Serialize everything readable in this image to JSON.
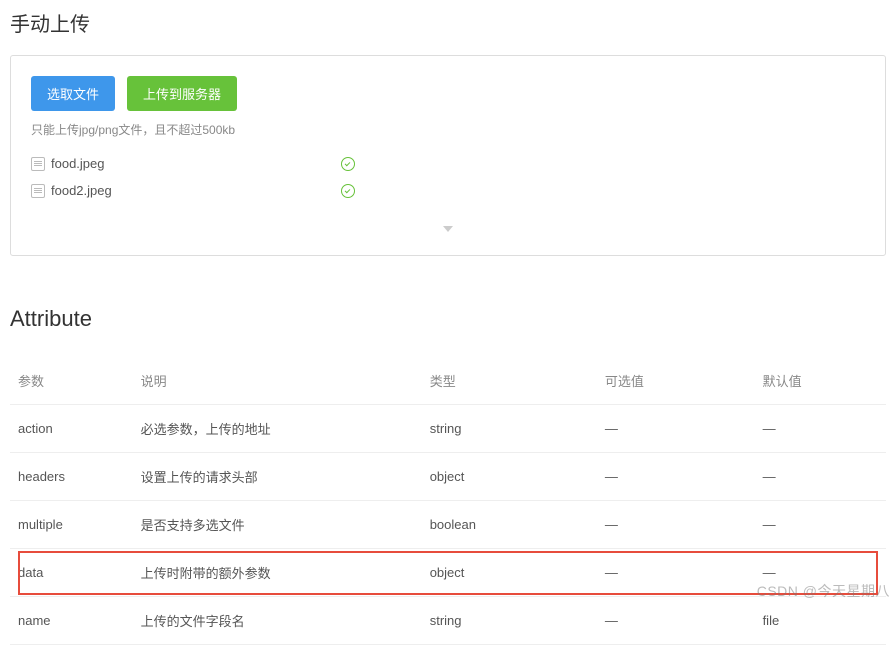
{
  "header": {
    "title": "手动上传"
  },
  "upload": {
    "select_btn": "选取文件",
    "submit_btn": "上传到服务器",
    "hint": "只能上传jpg/png文件，且不超过500kb",
    "files": [
      {
        "name": "food.jpeg"
      },
      {
        "name": "food2.jpeg"
      }
    ]
  },
  "attribute": {
    "title": "Attribute",
    "columns": {
      "param": "参数",
      "desc": "说明",
      "type": "类型",
      "options": "可选值",
      "default": "默认值"
    },
    "rows": [
      {
        "param": "action",
        "desc": "必选参数，上传的地址",
        "type": "string",
        "options": "—",
        "default": "—"
      },
      {
        "param": "headers",
        "desc": "设置上传的请求头部",
        "type": "object",
        "options": "—",
        "default": "—"
      },
      {
        "param": "multiple",
        "desc": "是否支持多选文件",
        "type": "boolean",
        "options": "—",
        "default": "—"
      },
      {
        "param": "data",
        "desc": "上传时附带的额外参数",
        "type": "object",
        "options": "—",
        "default": "—",
        "highlight": true
      },
      {
        "param": "name",
        "desc": "上传的文件字段名",
        "type": "string",
        "options": "—",
        "default": "file"
      }
    ]
  },
  "watermark": "CSDN @今天星期八"
}
